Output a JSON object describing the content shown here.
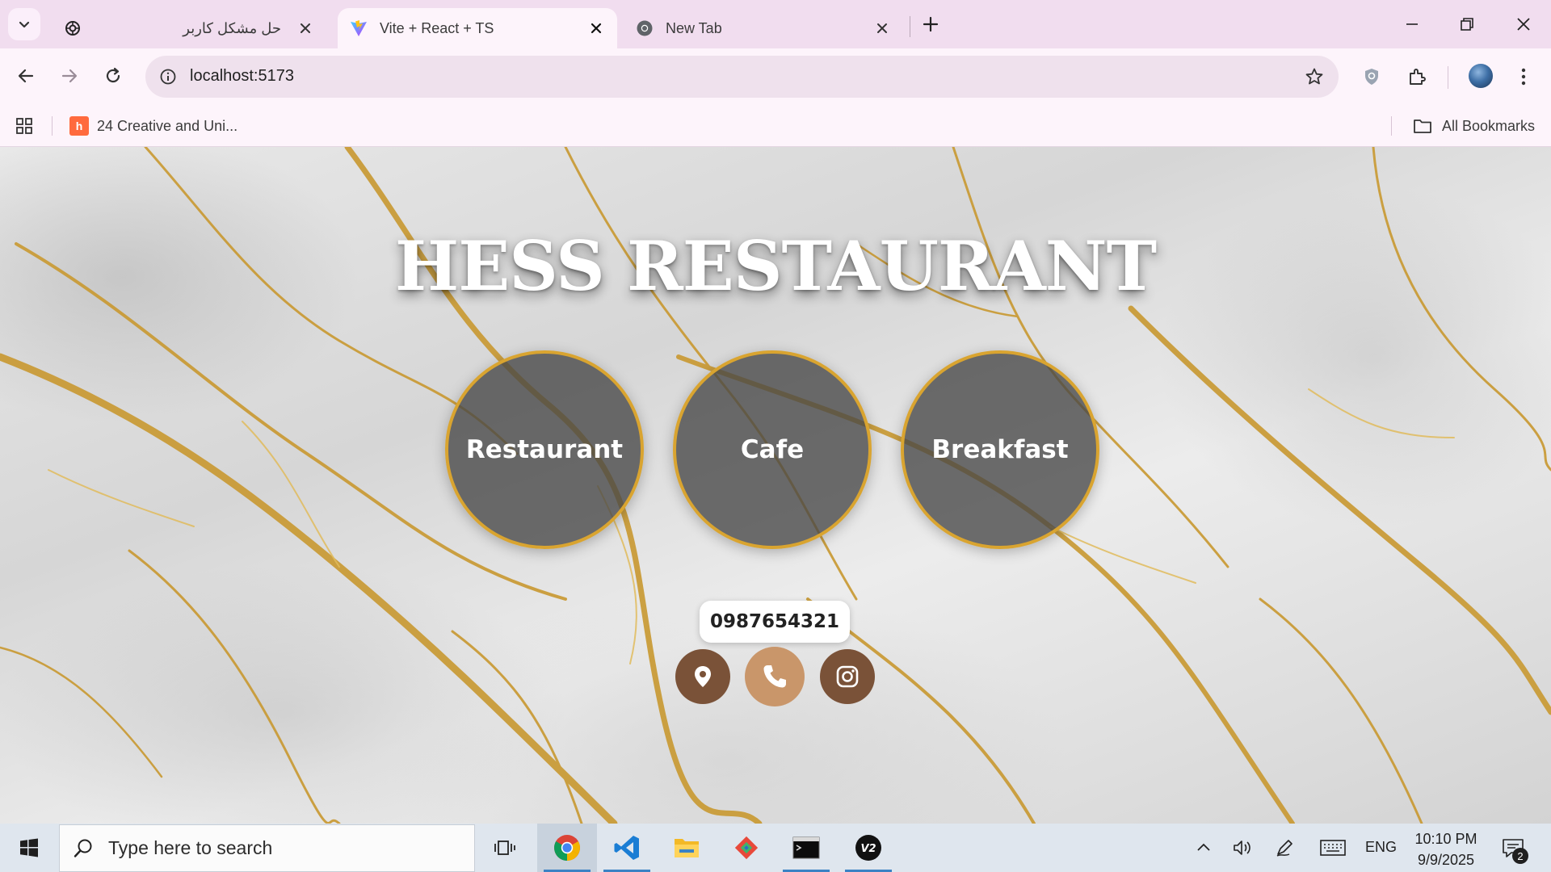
{
  "browser": {
    "tabs": [
      {
        "title": "حل مشکل کاربر",
        "active": false,
        "favicon": "chatgpt-icon"
      },
      {
        "title": "Vite + React + TS",
        "active": true,
        "favicon": "vite-icon"
      },
      {
        "title": "New Tab",
        "active": false,
        "favicon": "chrome-icon"
      }
    ],
    "url": "localhost:5173",
    "bookmarks": [
      {
        "label": "24 Creative and Uni...",
        "favicon": "hubspot-icon"
      }
    ],
    "all_bookmarks_label": "All Bookmarks"
  },
  "page": {
    "title": "HESS RESTAURANT",
    "categories": [
      {
        "label": "Restaurant"
      },
      {
        "label": "Cafe"
      },
      {
        "label": "Breakfast"
      }
    ],
    "phone": "0987654321",
    "social": [
      {
        "name": "location-icon",
        "color": "#7a5238"
      },
      {
        "name": "phone-icon",
        "color": "#c9966a"
      },
      {
        "name": "instagram-icon",
        "color": "#7a5238"
      }
    ],
    "colors": {
      "circle_border": "#d9a430",
      "circle_fill": "#464646",
      "title_text": "#ffffff"
    }
  },
  "taskbar": {
    "search_placeholder": "Type here to search",
    "apps": [
      "task-view-icon",
      "chrome-icon",
      "vscode-icon",
      "file-explorer-icon",
      "git-icon",
      "terminal-icon",
      "v2ray-icon"
    ],
    "language": "ENG",
    "time": "10:10 PM",
    "date": "9/9/2025",
    "notifications": "2"
  }
}
